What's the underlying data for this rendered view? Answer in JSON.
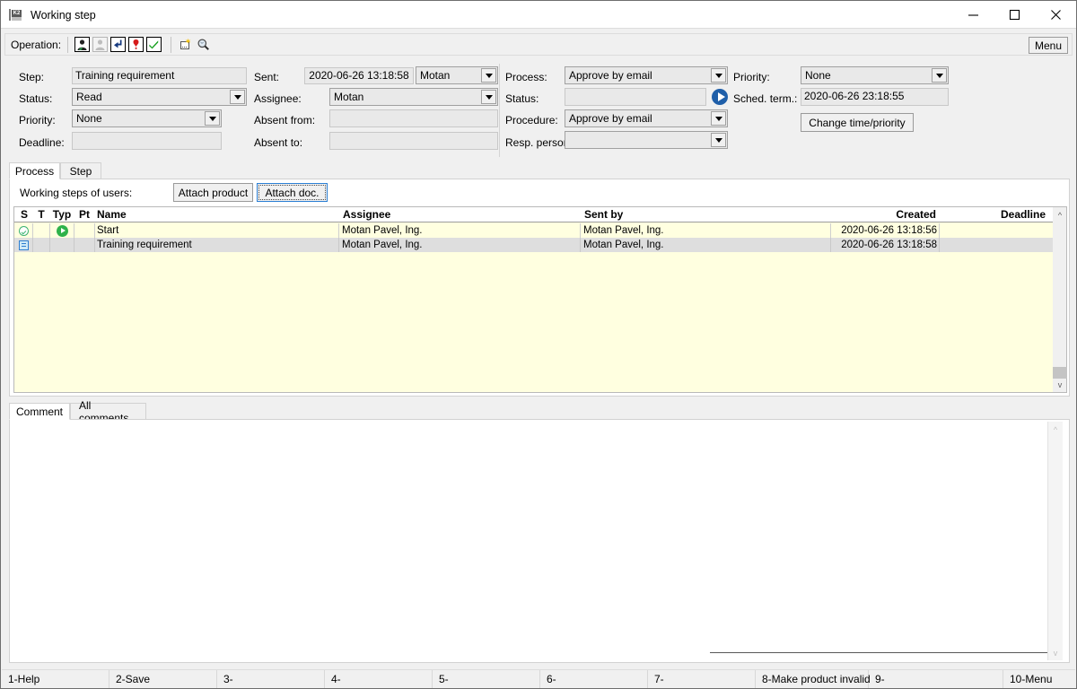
{
  "window": {
    "title": "Working step",
    "icon": "k2-app-icon",
    "minimize": "minimize-icon",
    "maximize": "maximize-icon",
    "close": "close-icon"
  },
  "toolbar": {
    "label": "Operation:",
    "menu_label": "Menu",
    "icons": [
      {
        "name": "person-icon",
        "glyph": "👤",
        "enabled": true
      },
      {
        "name": "person-disabled-icon",
        "glyph": "👤",
        "enabled": false
      },
      {
        "name": "forward-arrow-icon",
        "glyph": "↙",
        "enabled": true
      },
      {
        "name": "exclamation-icon",
        "glyph": "❗",
        "enabled": true
      },
      {
        "name": "approve-check-icon",
        "glyph": "✔",
        "enabled": true
      },
      {
        "name": "new-window-icon",
        "glyph": "▢",
        "enabled": true
      },
      {
        "name": "magnifier-icon",
        "glyph": "🔍",
        "enabled": true
      }
    ]
  },
  "form": {
    "left": {
      "step": {
        "label": "Step:",
        "value": "Training requirement"
      },
      "status": {
        "label": "Status:",
        "value": "Read"
      },
      "priority": {
        "label": "Priority:",
        "value": "None"
      },
      "deadline": {
        "label": "Deadline:",
        "value": ""
      }
    },
    "middle": {
      "sent": {
        "label": "Sent:",
        "value": "2020-06-26 13:18:58",
        "user": "Motan"
      },
      "assignee": {
        "label": "Assignee:",
        "value": "Motan"
      },
      "absent_from": {
        "label": "Absent from:",
        "value": ""
      },
      "absent_to": {
        "label": "Absent to:",
        "value": ""
      }
    },
    "right": {
      "process": {
        "label": "Process:",
        "value": "Approve by email"
      },
      "status": {
        "label": "Status:",
        "value": ""
      },
      "procedure": {
        "label": "Procedure:",
        "value": "Approve by email"
      },
      "resp_person": {
        "label": "Resp. person:",
        "value": ""
      },
      "run_icon": "run-process-icon"
    },
    "far_right": {
      "priority": {
        "label": "Priority:",
        "value": "None"
      },
      "sched_term": {
        "label": "Sched. term.:",
        "value": "2020-06-26 23:18:55"
      },
      "change_button": "Change time/priority"
    }
  },
  "main_tabs": [
    {
      "label": "Process",
      "active": true
    },
    {
      "label": "Step",
      "active": false
    }
  ],
  "process_pane": {
    "caption": "Working steps of users:",
    "attach_product_button": "Attach product",
    "attach_doc_button": "Attach doc."
  },
  "grid": {
    "columns": [
      {
        "key": "s",
        "label": "S",
        "align": "left"
      },
      {
        "key": "t",
        "label": "T",
        "align": "left"
      },
      {
        "key": "typ",
        "label": "Typ",
        "align": "left"
      },
      {
        "key": "pt",
        "label": "Pt",
        "align": "left"
      },
      {
        "key": "name",
        "label": "Name",
        "align": "left"
      },
      {
        "key": "assignee",
        "label": "Assignee",
        "align": "left"
      },
      {
        "key": "sent_by",
        "label": "Sent by",
        "align": "left"
      },
      {
        "key": "created",
        "label": "Created",
        "align": "right"
      },
      {
        "key": "deadline",
        "label": "Deadline",
        "align": "right"
      }
    ],
    "sort_indicator": "sort-ascending-icon",
    "rows": [
      {
        "s_icon": "status-completed-icon",
        "t": "",
        "typ_icon": "type-start-icon",
        "pt": "",
        "name": "Start",
        "assignee": "Motan Pavel, Ing.",
        "sent_by": "Motan Pavel, Ing.",
        "created": "2020-06-26 13:18:56",
        "deadline": ""
      },
      {
        "s_icon": "status-read-icon",
        "t": "",
        "typ_icon": "",
        "pt": "",
        "name": "Training requirement",
        "assignee": "Motan Pavel, Ing.",
        "sent_by": "Motan Pavel, Ing.",
        "created": "2020-06-26 13:18:58",
        "deadline": ""
      }
    ]
  },
  "comment_tabs": [
    {
      "label": "Comment",
      "active": true
    },
    {
      "label": "All comments",
      "active": false
    }
  ],
  "comment_value": "",
  "statusbar": [
    {
      "label": "1-Help"
    },
    {
      "label": "2-Save"
    },
    {
      "label": "3-"
    },
    {
      "label": "4-"
    },
    {
      "label": "5-"
    },
    {
      "label": "6-"
    },
    {
      "label": "7-"
    },
    {
      "label": "8-Make product invalid"
    },
    {
      "label": "9-"
    },
    {
      "label": "10-Menu"
    }
  ],
  "colors": {
    "grid_row_alt": "#ffffe0",
    "grid_row_selected": "#dedede",
    "accent_blue": "#1f5fa9",
    "focus_blue": "#2b7fd4",
    "status_green": "#2eb24a"
  }
}
